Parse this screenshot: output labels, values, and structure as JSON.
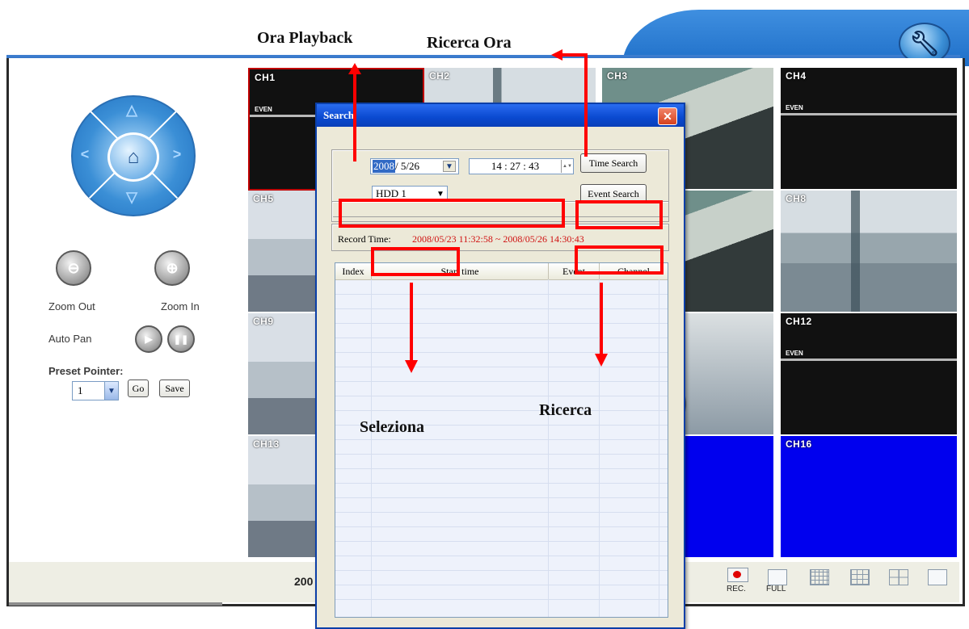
{
  "annotations": {
    "ora_playback": "Ora Playback",
    "ricerca_ora": "Ricerca Ora",
    "seleziona": "Seleziona",
    "ricerca": "Ricerca"
  },
  "left_panel": {
    "zoom_out": "Zoom Out",
    "zoom_in": "Zoom In",
    "auto_pan": "Auto Pan",
    "preset_pointer": "Preset Pointer:",
    "preset_value": "1",
    "go": "Go",
    "save": "Save"
  },
  "cameras": {
    "ch1": "CH1",
    "ch2": "CH2",
    "ch3": "CH3",
    "ch4": "CH4",
    "ch5": "CH5",
    "ch8": "CH8",
    "ch9": "CH9",
    "ch12": "CH12",
    "ch13": "CH13",
    "ch16": "CH16",
    "even": "EVEN"
  },
  "search_dialog": {
    "title": "Search",
    "date_year": "2008",
    "date_rest": "/ 5/26",
    "time": "14 : 27 : 43",
    "time_search": "Time Search",
    "hdd": "HDD 1",
    "event_search": "Event Search",
    "record_time_label": "Record Time:",
    "record_time_value": "2008/05/23 11:32:58 ~ 2008/05/26 14:30:43",
    "columns": [
      "Index",
      "Start time",
      "Event",
      "Channel"
    ]
  },
  "status_bar": {
    "date_partial": "200",
    "rec": "REC.",
    "full": "FULL"
  }
}
